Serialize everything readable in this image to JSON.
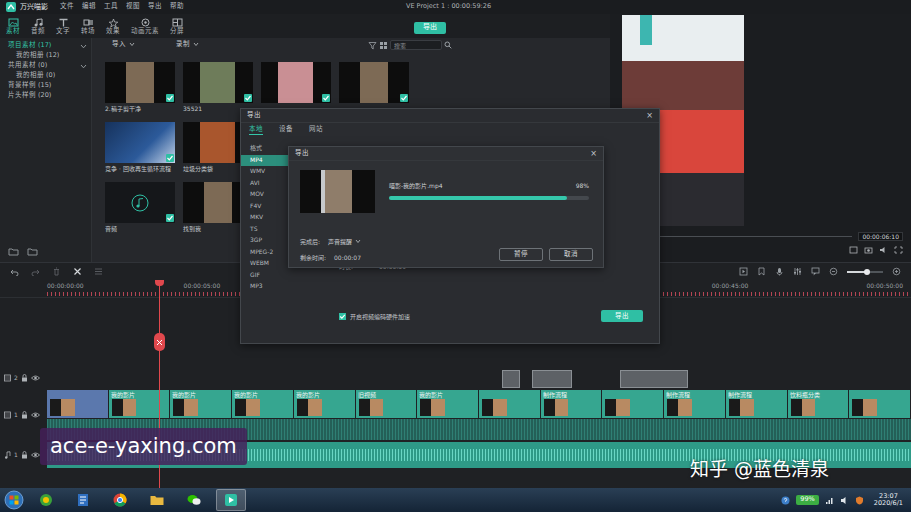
{
  "app": {
    "name": "万兴喵影",
    "menus": [
      "文件",
      "编辑",
      "工具",
      "视图",
      "导出",
      "帮助"
    ],
    "title": "VE Project 1 : 00:00:59:26"
  },
  "toolbar": {
    "tabs": [
      {
        "label": "素材",
        "selected": true
      },
      {
        "label": "音频",
        "selected": false
      },
      {
        "label": "文字",
        "selected": false
      },
      {
        "label": "转场",
        "selected": false
      },
      {
        "label": "效果",
        "selected": false
      },
      {
        "label": "动画元素",
        "selected": false
      },
      {
        "label": "分屏",
        "selected": false
      }
    ],
    "export": "导出"
  },
  "sidebar": {
    "items": [
      {
        "label": "项目素材 (17)",
        "kind": "group",
        "selected": true,
        "expanded": true
      },
      {
        "label": "我的相册 (12)",
        "kind": "child",
        "selected": false,
        "expanded": false
      },
      {
        "label": "共用素材 (0)",
        "kind": "group",
        "selected": false,
        "expanded": true
      },
      {
        "label": "我的相册 (0)",
        "kind": "child",
        "selected": false,
        "expanded": false
      },
      {
        "label": "背景样例 (15)",
        "kind": "group",
        "selected": false,
        "expanded": false
      },
      {
        "label": "片头样例 (20)",
        "kind": "group",
        "selected": false,
        "expanded": false
      }
    ]
  },
  "media": {
    "import": "导入",
    "record": "录制",
    "search_placeholder": "搜索",
    "items": [
      {
        "label": "2.稿子剪干净",
        "kind": "video",
        "checked": true
      },
      {
        "label": "35521",
        "kind": "video",
        "checked": true
      },
      {
        "kind": "video",
        "checked": true
      },
      {
        "kind": "video",
        "checked": true
      },
      {
        "label": "竞争 · 回收再生循环流程",
        "kind": "image",
        "checked": true
      },
      {
        "label": "垃圾分类袋",
        "kind": "video",
        "checked": true
      },
      {
        "kind": "video",
        "checked": false
      },
      {
        "kind": "video",
        "checked": false
      },
      {
        "label": "音频",
        "kind": "audio",
        "checked": true
      },
      {
        "label": "找到我",
        "kind": "video",
        "checked": true
      }
    ]
  },
  "preview": {
    "timecode": "00:00:06:10"
  },
  "export_dialog": {
    "title": "导出",
    "close": "×",
    "tabs": [
      {
        "label": "本地",
        "selected": true
      },
      {
        "label": "设备",
        "selected": false
      },
      {
        "label": "网站",
        "selected": false
      }
    ],
    "format_header": "格式",
    "formats": [
      {
        "label": "MP4",
        "selected": true
      },
      {
        "label": "WMV",
        "selected": false
      },
      {
        "label": "AVI",
        "selected": false
      },
      {
        "label": "MOV",
        "selected": false
      },
      {
        "label": "F4V",
        "selected": false
      },
      {
        "label": "MKV",
        "selected": false
      },
      {
        "label": "TS",
        "selected": false
      },
      {
        "label": "3GP",
        "selected": false
      },
      {
        "label": "MPEG-2",
        "selected": false
      },
      {
        "label": "WEBM",
        "selected": false
      },
      {
        "label": "GIF",
        "selected": false
      },
      {
        "label": "MP3",
        "selected": false
      }
    ],
    "duration_label": "时长:",
    "duration": "00:00:59",
    "hw_accel": {
      "label": "开启视频编码硬件加速",
      "checked": true
    },
    "export": "导出"
  },
  "progress_dialog": {
    "title": "导出",
    "close": "×",
    "file": "喵影-我的影片.mp4",
    "percent": "98%",
    "level": 0.89,
    "after_label": "完成后:",
    "after_value": "声音提醒",
    "remaining_label": "剩余时间:",
    "remaining": "00:00:07",
    "buttons": [
      "暂停",
      "取消"
    ]
  },
  "timeline": {
    "ruler": [
      "00:00:00:00",
      "00:00:05:00",
      "00:00:45:00",
      "00:00:50:00"
    ],
    "zoom_level": 0.55,
    "tracks": [
      {
        "label": "2",
        "kind": "video"
      },
      {
        "label": "1",
        "kind": "video"
      },
      {
        "label": "1",
        "kind": "audio"
      }
    ],
    "overlay_clips": [
      {
        "selected": false
      },
      {
        "selected": false
      },
      {
        "selected": false
      }
    ],
    "main_clips": [
      {
        "selected": true
      },
      {
        "label": "我的影片",
        "selected": false
      },
      {
        "label": "我的影片",
        "selected": false
      },
      {
        "label": "我的影片",
        "selected": false
      },
      {
        "label": "我的影片",
        "selected": false
      },
      {
        "label": "旧视频",
        "selected": false
      },
      {
        "label": "我的影片",
        "selected": false
      },
      {
        "selected": false
      },
      {
        "label": "制作流程",
        "selected": false
      },
      {
        "selected": false
      },
      {
        "label": "制作流程",
        "selected": false
      },
      {
        "label": "制作流程",
        "selected": false
      },
      {
        "label": "饮料瓶分类",
        "selected": false
      },
      {
        "selected": false
      }
    ]
  },
  "watermarks": [
    "ace-e-yaxing.com",
    "知乎 @蓝色清泉"
  ],
  "taskbar": {
    "apps": [
      {
        "active": false
      },
      {
        "active": false
      },
      {
        "active": false
      },
      {
        "active": false
      },
      {
        "active": false
      },
      {
        "active": true
      }
    ],
    "battery": "99%",
    "time": "23:07",
    "date": "2020/6/1"
  }
}
